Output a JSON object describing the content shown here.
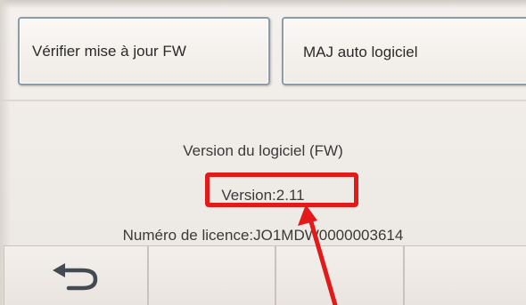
{
  "buttons": {
    "check_fw_update": "Vérifier mise à jour FW",
    "auto_update": "MAJ auto logiciel"
  },
  "info": {
    "title": "Version du logiciel (FW)",
    "version": "Version:2.11",
    "license": "Numéro de licence:JO1MDW0000003614"
  },
  "nav": {
    "back_icon": "return-arrow-icon"
  },
  "annotation": {
    "highlight_color": "#e21a1a"
  }
}
